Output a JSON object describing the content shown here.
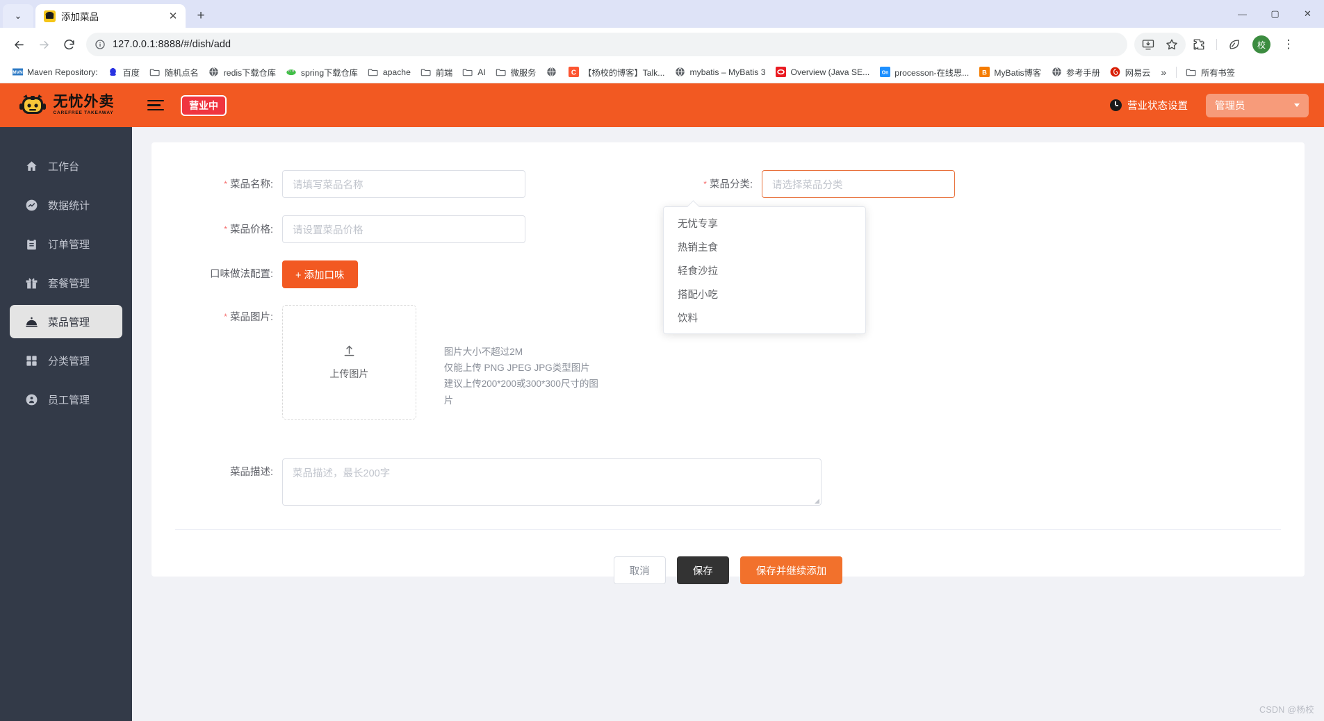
{
  "browser": {
    "tab": {
      "title": "添加菜品",
      "favicon_name": "site-favicon-robot",
      "close_label": "✕"
    },
    "tabstrip": {
      "chevron_label": "⌄",
      "newtab_label": "+"
    },
    "window_controls": {
      "minimize": "—",
      "maximize": "▢",
      "close": "✕"
    },
    "toolbar": {
      "back": "←",
      "forward": "→",
      "reload": "⟳",
      "site_info": "ⓘ",
      "url": "127.0.0.1:8888/#/dish/add",
      "install_icon": "install-icon",
      "bookmark_icon": "star-icon",
      "extensions_icon": "puzzle-icon",
      "performance_icon": "leaf-icon",
      "profile_initial": "校",
      "menu_icon": "⋮"
    },
    "bookmarks": [
      {
        "label": "Maven Repository:",
        "icon": "mvn-icon"
      },
      {
        "label": "百度",
        "icon": "baidu-icon"
      },
      {
        "label": "随机点名",
        "icon": "folder-icon"
      },
      {
        "label": "redis下载仓库",
        "icon": "globe-icon"
      },
      {
        "label": "spring下载仓库",
        "icon": "jfrog-icon"
      },
      {
        "label": "apache",
        "icon": "folder-icon"
      },
      {
        "label": "前端",
        "icon": "folder-icon"
      },
      {
        "label": "AI",
        "icon": "folder-icon"
      },
      {
        "label": "微服务",
        "icon": "folder-icon"
      },
      {
        "label": "",
        "icon": "globe-icon"
      },
      {
        "label": "【杨校的博客】Talk...",
        "icon": "csdn-icon"
      },
      {
        "label": "mybatis – MyBatis 3",
        "icon": "globe-icon"
      },
      {
        "label": "Overview (Java SE...",
        "icon": "oracle-icon"
      },
      {
        "label": "processon-在线思...",
        "icon": "processon-icon"
      },
      {
        "label": "MyBatis博客",
        "icon": "blogger-icon"
      },
      {
        "label": "参考手册",
        "icon": "globe-icon"
      },
      {
        "label": "网易云",
        "icon": "netease-icon"
      }
    ],
    "bookmarks_overflow": "»",
    "all_bookmarks": {
      "label": "所有书签",
      "icon": "folder-icon"
    }
  },
  "app": {
    "header": {
      "logo_cn": "无忧外卖",
      "logo_en": "CAREFREE TAKEAWAY",
      "menu_toggle_name": "collapse-menu-icon",
      "business_badge": "营业中",
      "status_setting": "营业状态设置",
      "status_icon": "clock-icon",
      "role": "管理员",
      "accent_orange": "#F25922",
      "badge_red": "#F0353F"
    },
    "sidebar": {
      "bg": "#333A48",
      "active_bg": "#E4E4E4",
      "items": [
        {
          "label": "工作台",
          "icon": "home-icon",
          "active": false
        },
        {
          "label": "数据统计",
          "icon": "chart-icon",
          "active": false
        },
        {
          "label": "订单管理",
          "icon": "clipboard-icon",
          "active": false
        },
        {
          "label": "套餐管理",
          "icon": "gift-icon",
          "active": false
        },
        {
          "label": "菜品管理",
          "icon": "dish-icon",
          "active": true
        },
        {
          "label": "分类管理",
          "icon": "grid-icon",
          "active": false
        },
        {
          "label": "员工管理",
          "icon": "user-icon",
          "active": false
        }
      ]
    },
    "form": {
      "dish_name": {
        "label": "菜品名称:",
        "required": true,
        "value": "",
        "placeholder": "请填写菜品名称"
      },
      "dish_price": {
        "label": "菜品价格:",
        "required": true,
        "value": "",
        "placeholder": "请设置菜品价格"
      },
      "flavor": {
        "label": "口味做法配置:",
        "required": false,
        "button": "+ 添加口味"
      },
      "dish_image": {
        "label": "菜品图片:",
        "required": true,
        "upload_text": "上传图片",
        "upload_icon": "upload-icon"
      },
      "image_hints": [
        "图片大小不超过2M",
        "仅能上传 PNG JPEG JPG类型图片",
        "建议上传200*200或300*300尺寸的图片"
      ],
      "dish_category": {
        "label": "菜品分类:",
        "required": true,
        "value": "",
        "placeholder": "请选择菜品分类",
        "focused": true,
        "options": [
          "无忧专享",
          "热销主食",
          "轻食沙拉",
          "搭配小吃",
          "饮料"
        ]
      },
      "dish_desc": {
        "label": "菜品描述:",
        "required": false,
        "value": "",
        "placeholder": "菜品描述，最长200字"
      }
    },
    "actions": {
      "cancel": "取消",
      "save": "保存",
      "save_and_continue": "保存并继续添加"
    },
    "watermark": "CSDN @杨校"
  }
}
